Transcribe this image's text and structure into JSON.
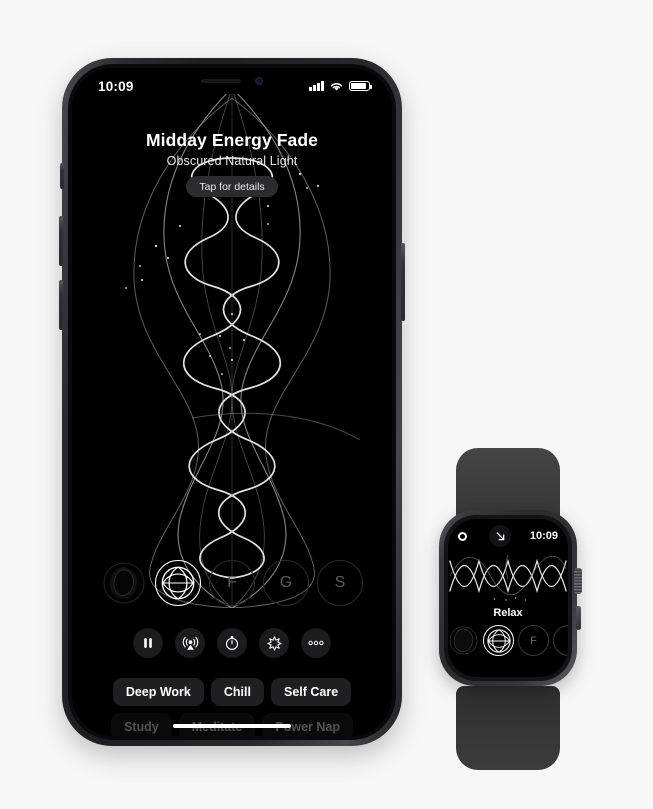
{
  "background_color": "#f7f7f7",
  "phone": {
    "status_bar": {
      "time": "10:09",
      "signal_icon": "cellular-bars-icon",
      "wifi_icon": "wifi-icon",
      "battery_icon": "battery-icon"
    },
    "header": {
      "title": "Midday Energy Fade",
      "subtitle": "Obscured Natural Light",
      "details_pill": "Tap for details"
    },
    "visualization": {
      "name": "soundscape-wave-visualization",
      "stroke_color": "#cfcfcf"
    },
    "modes": [
      {
        "label": "",
        "icon": "blob-icon",
        "active": false
      },
      {
        "label": "",
        "icon": "endel-logo-icon",
        "active": true
      },
      {
        "label": "F",
        "icon": "focus-mode-icon",
        "active": false
      },
      {
        "label": "G",
        "icon": "guided-mode-icon",
        "active": false
      },
      {
        "label": "S",
        "icon": "sleep-mode-icon",
        "active": false
      }
    ],
    "controls": [
      {
        "name": "pause-button",
        "icon": "pause-icon"
      },
      {
        "name": "airplay-button",
        "icon": "airplay-icon"
      },
      {
        "name": "timer-button",
        "icon": "timer-icon"
      },
      {
        "name": "intensity-button",
        "icon": "sparkle-icon"
      },
      {
        "name": "more-button",
        "icon": "ellipsis-icon"
      }
    ],
    "chips_row_1": [
      "Deep Work",
      "Chill",
      "Self Care"
    ],
    "chips_row_2": [
      "Study",
      "Meditate",
      "Power Nap"
    ],
    "home_indicator": "home-indicator"
  },
  "watch": {
    "status": {
      "ring_icon": "activity-ring-icon",
      "arrow_icon": "arrow-down-right-icon",
      "time": "10:09"
    },
    "visualization": {
      "name": "watch-wave-visualization",
      "stroke_color": "#e8e8e8"
    },
    "label": "Relax",
    "modes": [
      {
        "label": "",
        "icon": "blob-icon",
        "active": false
      },
      {
        "label": "",
        "icon": "endel-logo-icon",
        "active": true
      },
      {
        "label": "F",
        "icon": "focus-mode-icon",
        "active": false
      },
      {
        "label": "",
        "icon": "partial-mode-icon",
        "active": false
      }
    ],
    "case_color": "#35353a",
    "band_color": "#3a3a3a"
  }
}
